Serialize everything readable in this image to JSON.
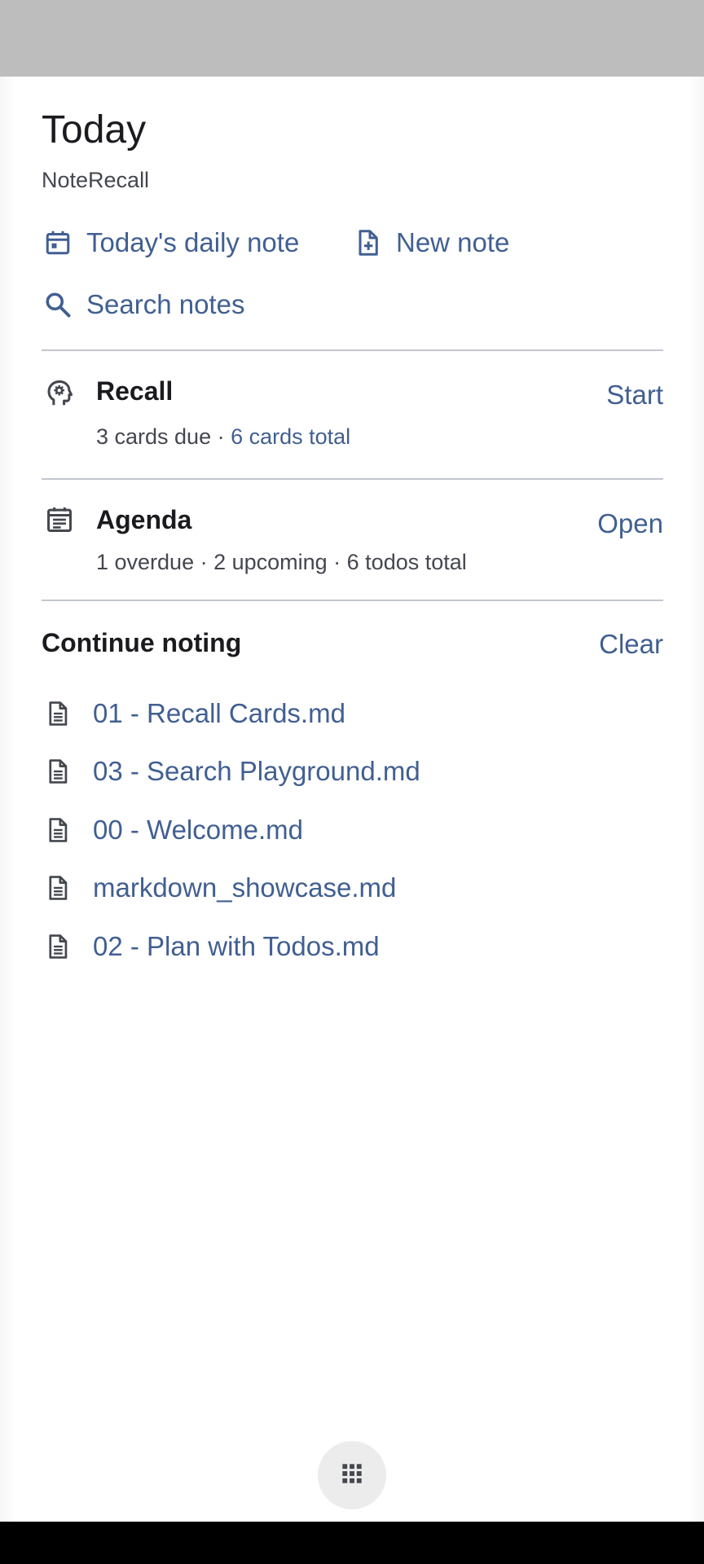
{
  "header": {
    "title": "Today",
    "subtitle": "NoteRecall"
  },
  "actions": {
    "daily_note": {
      "label": "Today's daily note",
      "icon": "calendar-icon"
    },
    "new_note": {
      "label": "New note",
      "icon": "file-plus-icon"
    },
    "search": {
      "label": "Search notes",
      "icon": "search-icon"
    }
  },
  "recall": {
    "title": "Recall",
    "due": "3 cards due",
    "separator": " · ",
    "total": "6 cards total",
    "button": "Start",
    "icon": "brain-head-icon"
  },
  "agenda": {
    "title": "Agenda",
    "summary": "1 overdue · 2 upcoming · 6 todos total",
    "button": "Open",
    "icon": "agenda-icon"
  },
  "continue": {
    "title": "Continue noting",
    "clear": "Clear",
    "items": [
      {
        "label": "01 - Recall Cards.md",
        "icon": "document-icon"
      },
      {
        "label": "03 - Search Playground.md",
        "icon": "document-icon"
      },
      {
        "label": "00 - Welcome.md",
        "icon": "document-icon"
      },
      {
        "label": "markdown_showcase.md",
        "icon": "document-icon"
      },
      {
        "label": "02 - Plan with Todos.md",
        "icon": "document-icon"
      }
    ]
  },
  "fab": {
    "icon": "apps-grid-icon"
  },
  "colors": {
    "accent": "#415f91",
    "text": "#1b1b1f",
    "secondary_text": "#44474e",
    "divider": "#c4c6d0",
    "status_bar": "#bdbdbd",
    "nav_bar": "#000000"
  }
}
